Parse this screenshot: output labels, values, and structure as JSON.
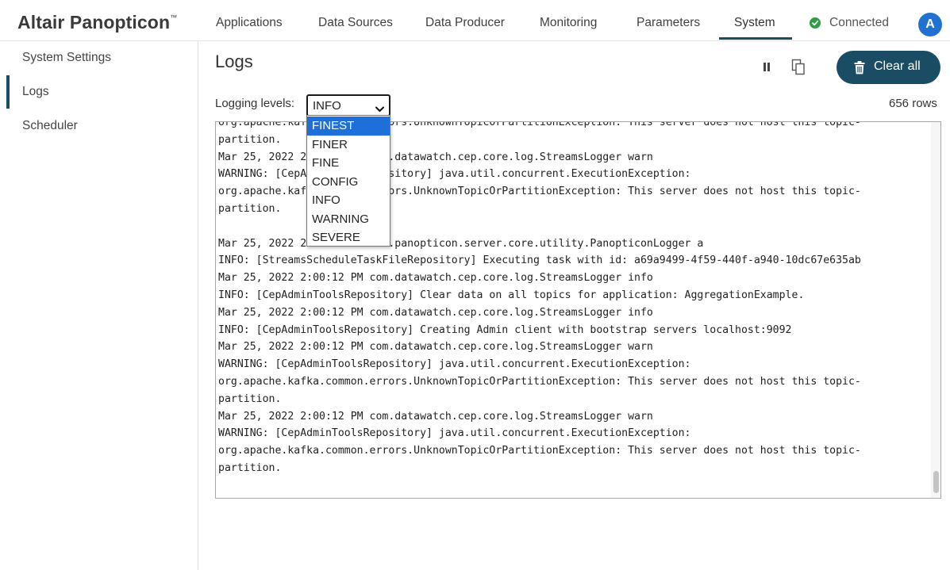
{
  "brand": {
    "name": "Altair Panopticon",
    "mark": "™"
  },
  "nav": {
    "tabs": [
      {
        "label": "Applications"
      },
      {
        "label": "Data Sources"
      },
      {
        "label": "Data Producer"
      },
      {
        "label": "Monitoring"
      },
      {
        "label": "Parameters"
      },
      {
        "label": "System"
      }
    ],
    "active_tab": "System",
    "status": "Connected",
    "avatar_initial": "A"
  },
  "sidebar": {
    "items": [
      {
        "label": "System Settings"
      },
      {
        "label": "Logs"
      },
      {
        "label": "Scheduler"
      }
    ],
    "active_item": "Logs"
  },
  "main": {
    "title": "Logs",
    "clear_label": "Clear all",
    "levels_label": "Logging levels:",
    "selected_level": "INFO",
    "row_count": "656 rows",
    "level_options": [
      "FINEST",
      "FINER",
      "FINE",
      "CONFIG",
      "INFO",
      "WARNING",
      "SEVERE"
    ],
    "highlighted_option": "FINEST",
    "log_lines": [
      "org.apache.kafka.common.errors.UnknownTopicOrPartitionException: This server does not host this topic-",
      "partition.",
      "Mar 25, 2022 2:00:12 PM com.datawatch.cep.core.log.StreamsLogger warn",
      "WARNING: [CepAdminToolsRepository] java.util.concurrent.ExecutionException:",
      "org.apache.kafka.common.errors.UnknownTopicOrPartitionException: This server does not host this topic-",
      "partition.",
      "",
      "Mar 25, 2022 2:00:12 PM com.panopticon.server.core.utility.PanopticonLogger a",
      "INFO: [StreamsScheduleTaskFileRepository] Executing task with id: a69a9499-4f59-440f-a940-10dc67e635ab",
      "Mar 25, 2022 2:00:12 PM com.datawatch.cep.core.log.StreamsLogger info",
      "INFO: [CepAdminToolsRepository] Clear data on all topics for application: AggregationExample.",
      "Mar 25, 2022 2:00:12 PM com.datawatch.cep.core.log.StreamsLogger info",
      "INFO: [CepAdminToolsRepository] Creating Admin client with bootstrap servers localhost:9092",
      "Mar 25, 2022 2:00:12 PM com.datawatch.cep.core.log.StreamsLogger warn",
      "WARNING: [CepAdminToolsRepository] java.util.concurrent.ExecutionException:",
      "org.apache.kafka.common.errors.UnknownTopicOrPartitionException: This server does not host this topic-",
      "partition.",
      "Mar 25, 2022 2:00:12 PM com.datawatch.cep.core.log.StreamsLogger warn",
      "WARNING: [CepAdminToolsRepository] java.util.concurrent.ExecutionException:",
      "org.apache.kafka.common.errors.UnknownTopicOrPartitionException: This server does not host this topic-",
      "partition."
    ]
  },
  "icons": {
    "pause": "pause-icon",
    "copy": "copy-icon",
    "trash": "trash-icon",
    "status": "check-circle-icon",
    "chevron": "chevron-down-icon"
  },
  "colors": {
    "accent": "#1a4d64",
    "status_ok": "#2e9e45",
    "avatar": "#1f72d1",
    "selection": "#1f6fd8"
  }
}
